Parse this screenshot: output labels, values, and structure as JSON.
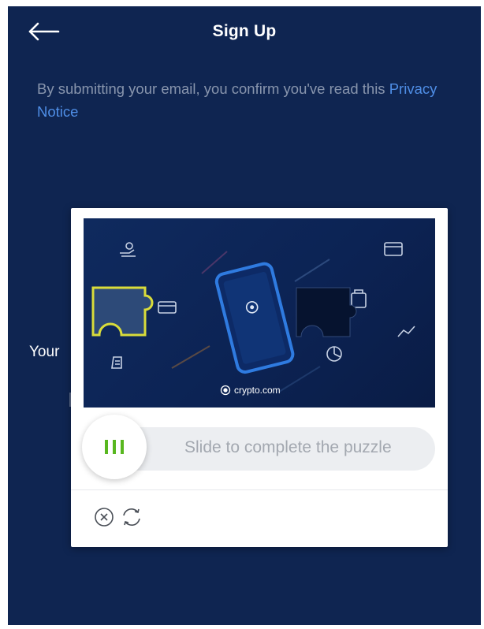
{
  "header": {
    "title": "Sign Up",
    "back_icon": "arrow-left-icon"
  },
  "notice": {
    "text": "By submitting your email, you confirm you've read this ",
    "link": "Privacy Notice"
  },
  "background_form": {
    "label_partial": "Your"
  },
  "captcha": {
    "brand": "crypto.com",
    "slider_hint": "Slide to complete the puzzle",
    "slider_progress": 0,
    "handle_icon": "grip-bars-icon",
    "close_icon": "close-circle-icon",
    "refresh_icon": "refresh-icon"
  },
  "colors": {
    "app_background": "#0f2551",
    "link": "#4f8ee6",
    "puzzle_piece_outline": "#d9dc3a",
    "handle_grip": "#58b71f"
  }
}
